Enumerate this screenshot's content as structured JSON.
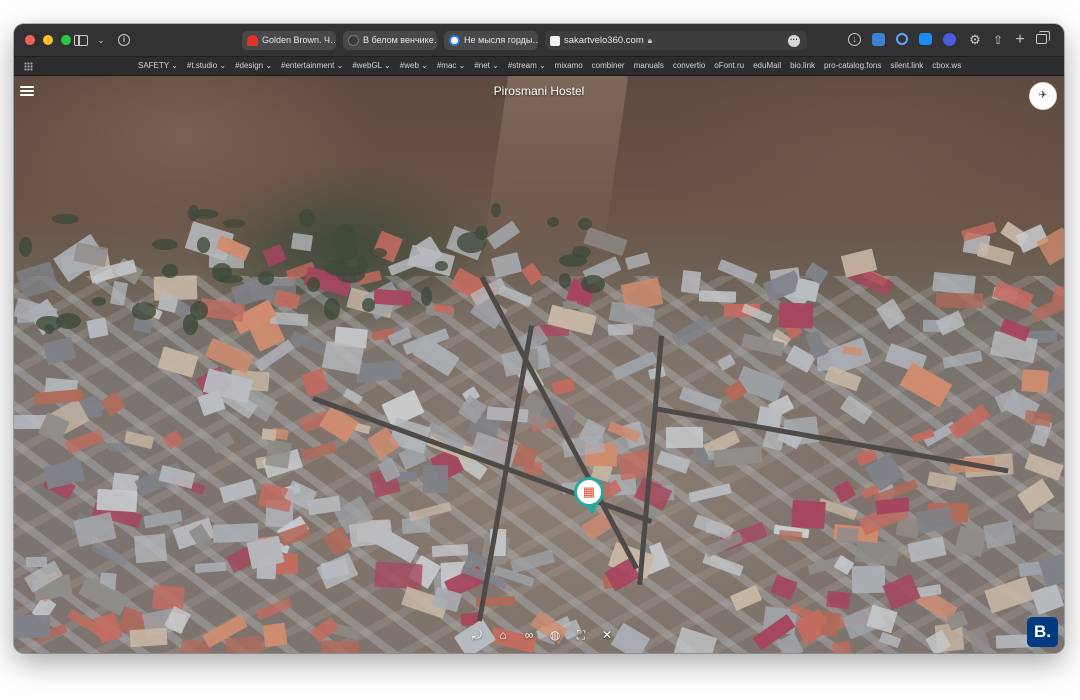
{
  "browser": {
    "tabs": [
      {
        "label": "Golden Brown. Ч…"
      },
      {
        "label": "В белом венчике…"
      },
      {
        "label": "Не мысля горды…"
      }
    ],
    "active_tab": {
      "url": "sakartvelo360.com"
    },
    "bookmarks": [
      "SAFETY ⌄",
      "#t.studio ⌄",
      "#design ⌄",
      "#entertainment ⌄",
      "#webGL ⌄",
      "#web ⌄",
      "#mac ⌄",
      "#net ⌄",
      "#stream ⌄",
      "mixamo",
      "combiner",
      "manuals",
      "convertio",
      "oFont.ru",
      "eduMail",
      "bio.link",
      "pro-catalog.fons",
      "silent.link",
      "cbox.ws"
    ]
  },
  "page": {
    "title": "Pirosmani Hostel",
    "badge": "B."
  },
  "icons": {
    "menu": "hamburger-icon",
    "logo": "drone-logo-icon",
    "pin": "hotel-pin-icon",
    "controls": [
      "rotate-icon",
      "home-icon",
      "vr-icon",
      "globe-icon",
      "fullscreen-icon",
      "close-icon"
    ]
  },
  "colors": {
    "booking_blue": "#003a80",
    "pin_teal": "#2aa69e"
  }
}
